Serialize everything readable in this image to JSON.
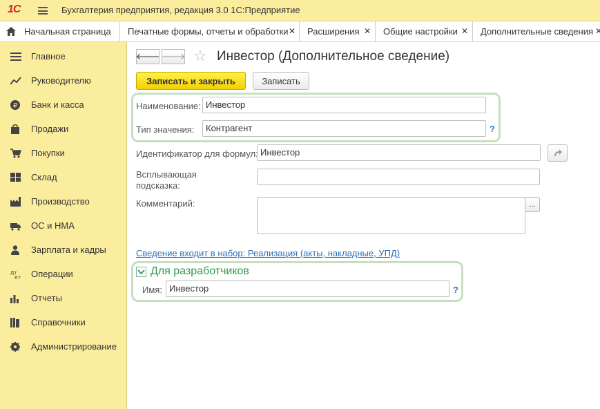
{
  "titlebar": {
    "logo": "1С",
    "app_title": "Бухгалтерия предприятия, редакция 3.0 1С:Предприятие"
  },
  "tabs": [
    {
      "label": "Начальная страница"
    },
    {
      "label": "Печатные формы, отчеты и обработки"
    },
    {
      "label": "Расширения"
    },
    {
      "label": "Общие настройки"
    },
    {
      "label": "Дополнительные сведения"
    }
  ],
  "tab_close": "✕",
  "sidebar": {
    "items": [
      {
        "label": "Главное",
        "icon": "menu-lines-icon"
      },
      {
        "label": "Руководителю",
        "icon": "trend-icon"
      },
      {
        "label": "Банк и касса",
        "icon": "ruble-icon"
      },
      {
        "label": "Продажи",
        "icon": "bag-icon"
      },
      {
        "label": "Покупки",
        "icon": "cart-icon"
      },
      {
        "label": "Склад",
        "icon": "grid-icon"
      },
      {
        "label": "Производство",
        "icon": "factory-icon"
      },
      {
        "label": "ОС и НМА",
        "icon": "truck-icon"
      },
      {
        "label": "Зарплата и кадры",
        "icon": "person-icon"
      },
      {
        "label": "Операции",
        "icon": "dt-kt-icon"
      },
      {
        "label": "Отчеты",
        "icon": "bar-chart-icon"
      },
      {
        "label": "Справочники",
        "icon": "books-icon"
      },
      {
        "label": "Администрирование",
        "icon": "gear-icon"
      }
    ]
  },
  "form": {
    "title": "Инвестор (Дополнительное сведение)",
    "back_arrow": "🡐",
    "forward_arrow": "🡒",
    "star": "☆",
    "save_close_label": "Записать и закрыть",
    "save_label": "Записать",
    "name_label": "Наименование:",
    "name_value": "Инвестор",
    "type_label": "Тип значения:",
    "type_value": "Контрагент",
    "formula_id_label": "Идентификатор для формул:",
    "formula_id_value": "Инвестор",
    "tooltip_label": "Всплывающая подсказка:",
    "tooltip_value": "",
    "comment_label": "Комментарий:",
    "comment_value": "",
    "ellipsis": "...",
    "help": "?",
    "set_link": "Сведение входит в набор: Реализация (акты, накладные, УПД)",
    "dev_section_title": "Для разработчиков",
    "dev_name_label": "Имя:",
    "dev_name_value": "Инвестор"
  },
  "colors": {
    "sidebar_bg": "#fbed9e",
    "primary_button": "#f4d000",
    "group_border": "#c7dfbf",
    "link": "#2a6db5",
    "dev_title": "#2f9a4b"
  }
}
